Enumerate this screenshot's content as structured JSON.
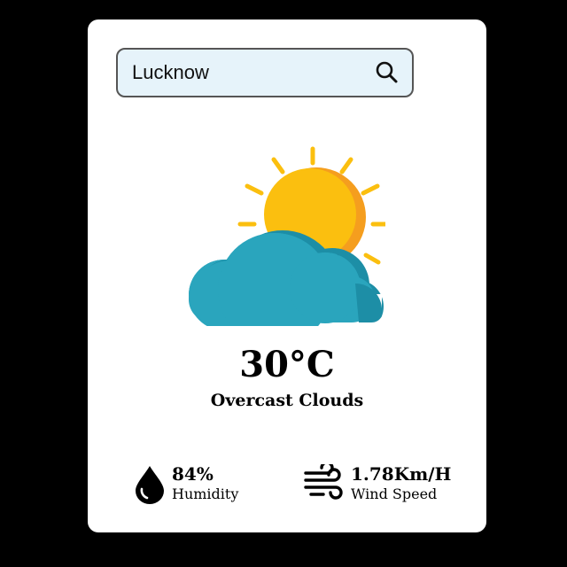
{
  "search": {
    "value": "Lucknow",
    "icon": "search-icon"
  },
  "weather": {
    "icon": "sun-behind-cloud-icon",
    "temperature": "30°C",
    "condition": "Overcast Clouds"
  },
  "humidity": {
    "value": "84%",
    "label": "Humidity",
    "icon": "water-drop-icon"
  },
  "wind": {
    "value": "1.78Km/H",
    "label": "Wind Speed",
    "icon": "wind-icon"
  },
  "colors": {
    "sun": "#fbbf0f",
    "sun_shade": "#f59e1e",
    "cloud": "#2aa5bd",
    "cloud_shade": "#1d8ea6",
    "search_bg": "#e6f3fa"
  }
}
